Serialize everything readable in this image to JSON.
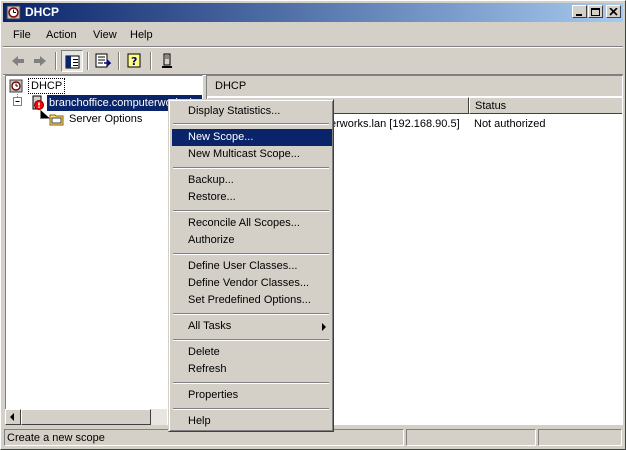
{
  "window": {
    "title": "DHCP"
  },
  "menubar": {
    "items": [
      "File",
      "Action",
      "View",
      "Help"
    ]
  },
  "tree": {
    "root": "DHCP",
    "server": "branchoffice.computerworks.lan",
    "child": "Server Options"
  },
  "list": {
    "header": "DHCP",
    "columns": [
      "Status"
    ],
    "row": {
      "name": "erworks.lan [192.168.90.5]",
      "status": "Not authorized"
    }
  },
  "context_menu": {
    "items": [
      "Display Statistics...",
      "New Scope...",
      "New Multicast Scope...",
      "Backup...",
      "Restore...",
      "Reconcile All Scopes...",
      "Authorize",
      "Define User Classes...",
      "Define Vendor Classes...",
      "Set Predefined Options...",
      "All Tasks",
      "Delete",
      "Refresh",
      "Properties",
      "Help"
    ],
    "highlighted": "New Scope..."
  },
  "statusbar": {
    "text": "Create a new scope"
  },
  "colors": {
    "title_start": "#0a246a",
    "title_end": "#a6caf0",
    "selection": "#0a246a",
    "face": "#d4d0c8"
  },
  "icons": [
    "dhcp-app-icon",
    "minimize-icon",
    "maximize-icon",
    "close-icon",
    "back-arrow-icon",
    "forward-arrow-icon",
    "show-hide-tree-icon",
    "export-list-icon",
    "help-icon",
    "server-add-icon",
    "server-not-authorized-icon",
    "folder-icon"
  ]
}
